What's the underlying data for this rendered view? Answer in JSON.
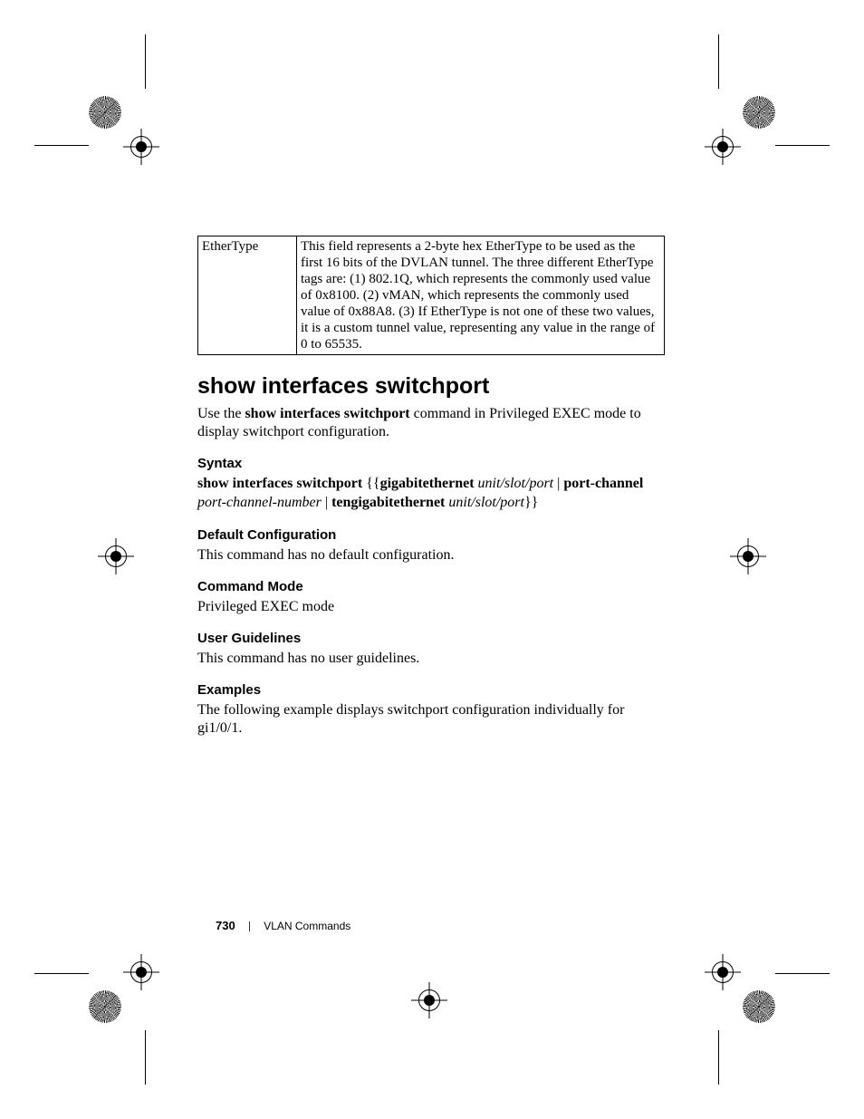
{
  "table": {
    "col1": "EtherType",
    "col2": "This field represents a 2-byte hex EtherType to be used as the first 16 bits of the DVLAN tunnel. The three different EtherType tags are: (1) 802.1Q, which represents the commonly used value of 0x8100. (2) vMAN, which represents the commonly used value of 0x88A8. (3) If EtherType is not one of these two values, it is a custom tunnel value, representing any value in the range of 0 to 65535."
  },
  "command": {
    "title": "show interfaces switchport",
    "intro_pre": "Use the ",
    "intro_bold": "show interfaces switchport",
    "intro_post": " command in Privileged EXEC mode to display switchport configuration."
  },
  "syntax": {
    "heading": "Syntax",
    "cmd": "show interfaces switchport",
    "open": " {{",
    "gbe": "gigabitethernet",
    "arg1": "unit/slot/port",
    "pipe1": " | ",
    "pc": "port-channel",
    "pcn": "port-channel-number",
    "pipe2": " | ",
    "tge": "tengigabitethernet",
    "arg2": "unit/slot/port",
    "close": "}}"
  },
  "defcfg": {
    "heading": "Default Configuration",
    "body": "This command has no default configuration."
  },
  "mode": {
    "heading": "Command Mode",
    "body": "Privileged EXEC mode"
  },
  "ug": {
    "heading": "User Guidelines",
    "body": "This command has no user guidelines."
  },
  "ex": {
    "heading": "Examples",
    "body": "The following example displays switchport configuration individually for gi1/0/1."
  },
  "footer": {
    "page": "730",
    "section": "VLAN Commands"
  }
}
